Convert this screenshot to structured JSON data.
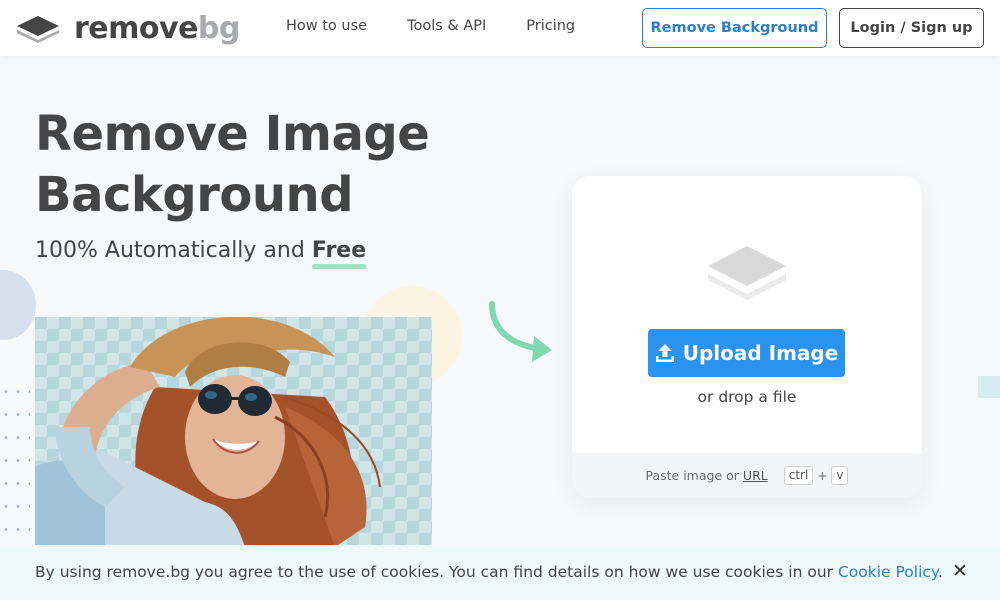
{
  "header": {
    "logo": {
      "word_dark": "remove",
      "word_light": "bg"
    },
    "nav": [
      {
        "label": "How to use"
      },
      {
        "label": "Tools & API"
      },
      {
        "label": "Pricing"
      }
    ],
    "remove_bg_button": "Remove Background",
    "login_button": "Login / Sign up"
  },
  "hero": {
    "title_line1": "Remove Image",
    "title_line2": "Background",
    "subtitle_prefix": "100% Automatically and ",
    "subtitle_highlight": "Free"
  },
  "upload_card": {
    "icon": "layers-icon",
    "upload_button": "Upload Image",
    "upload_icon": "upload-icon",
    "drop_text": "or drop a file",
    "paste_prefix": "Paste image or ",
    "paste_link": "URL",
    "shortcut_key1": "ctrl",
    "shortcut_plus": "+",
    "shortcut_key2": "v"
  },
  "cookie_bar": {
    "text": "By using remove.bg you agree to the use of cookies. You can find details on how we use cookies in our ",
    "link": "Cookie Policy",
    "suffix": ".",
    "close_icon": "close-icon"
  },
  "colors": {
    "brand_blue": "#2a93f0",
    "link_blue": "#2a7fd3",
    "text_dark": "#454545",
    "accent_green": "#9ee4c4"
  }
}
